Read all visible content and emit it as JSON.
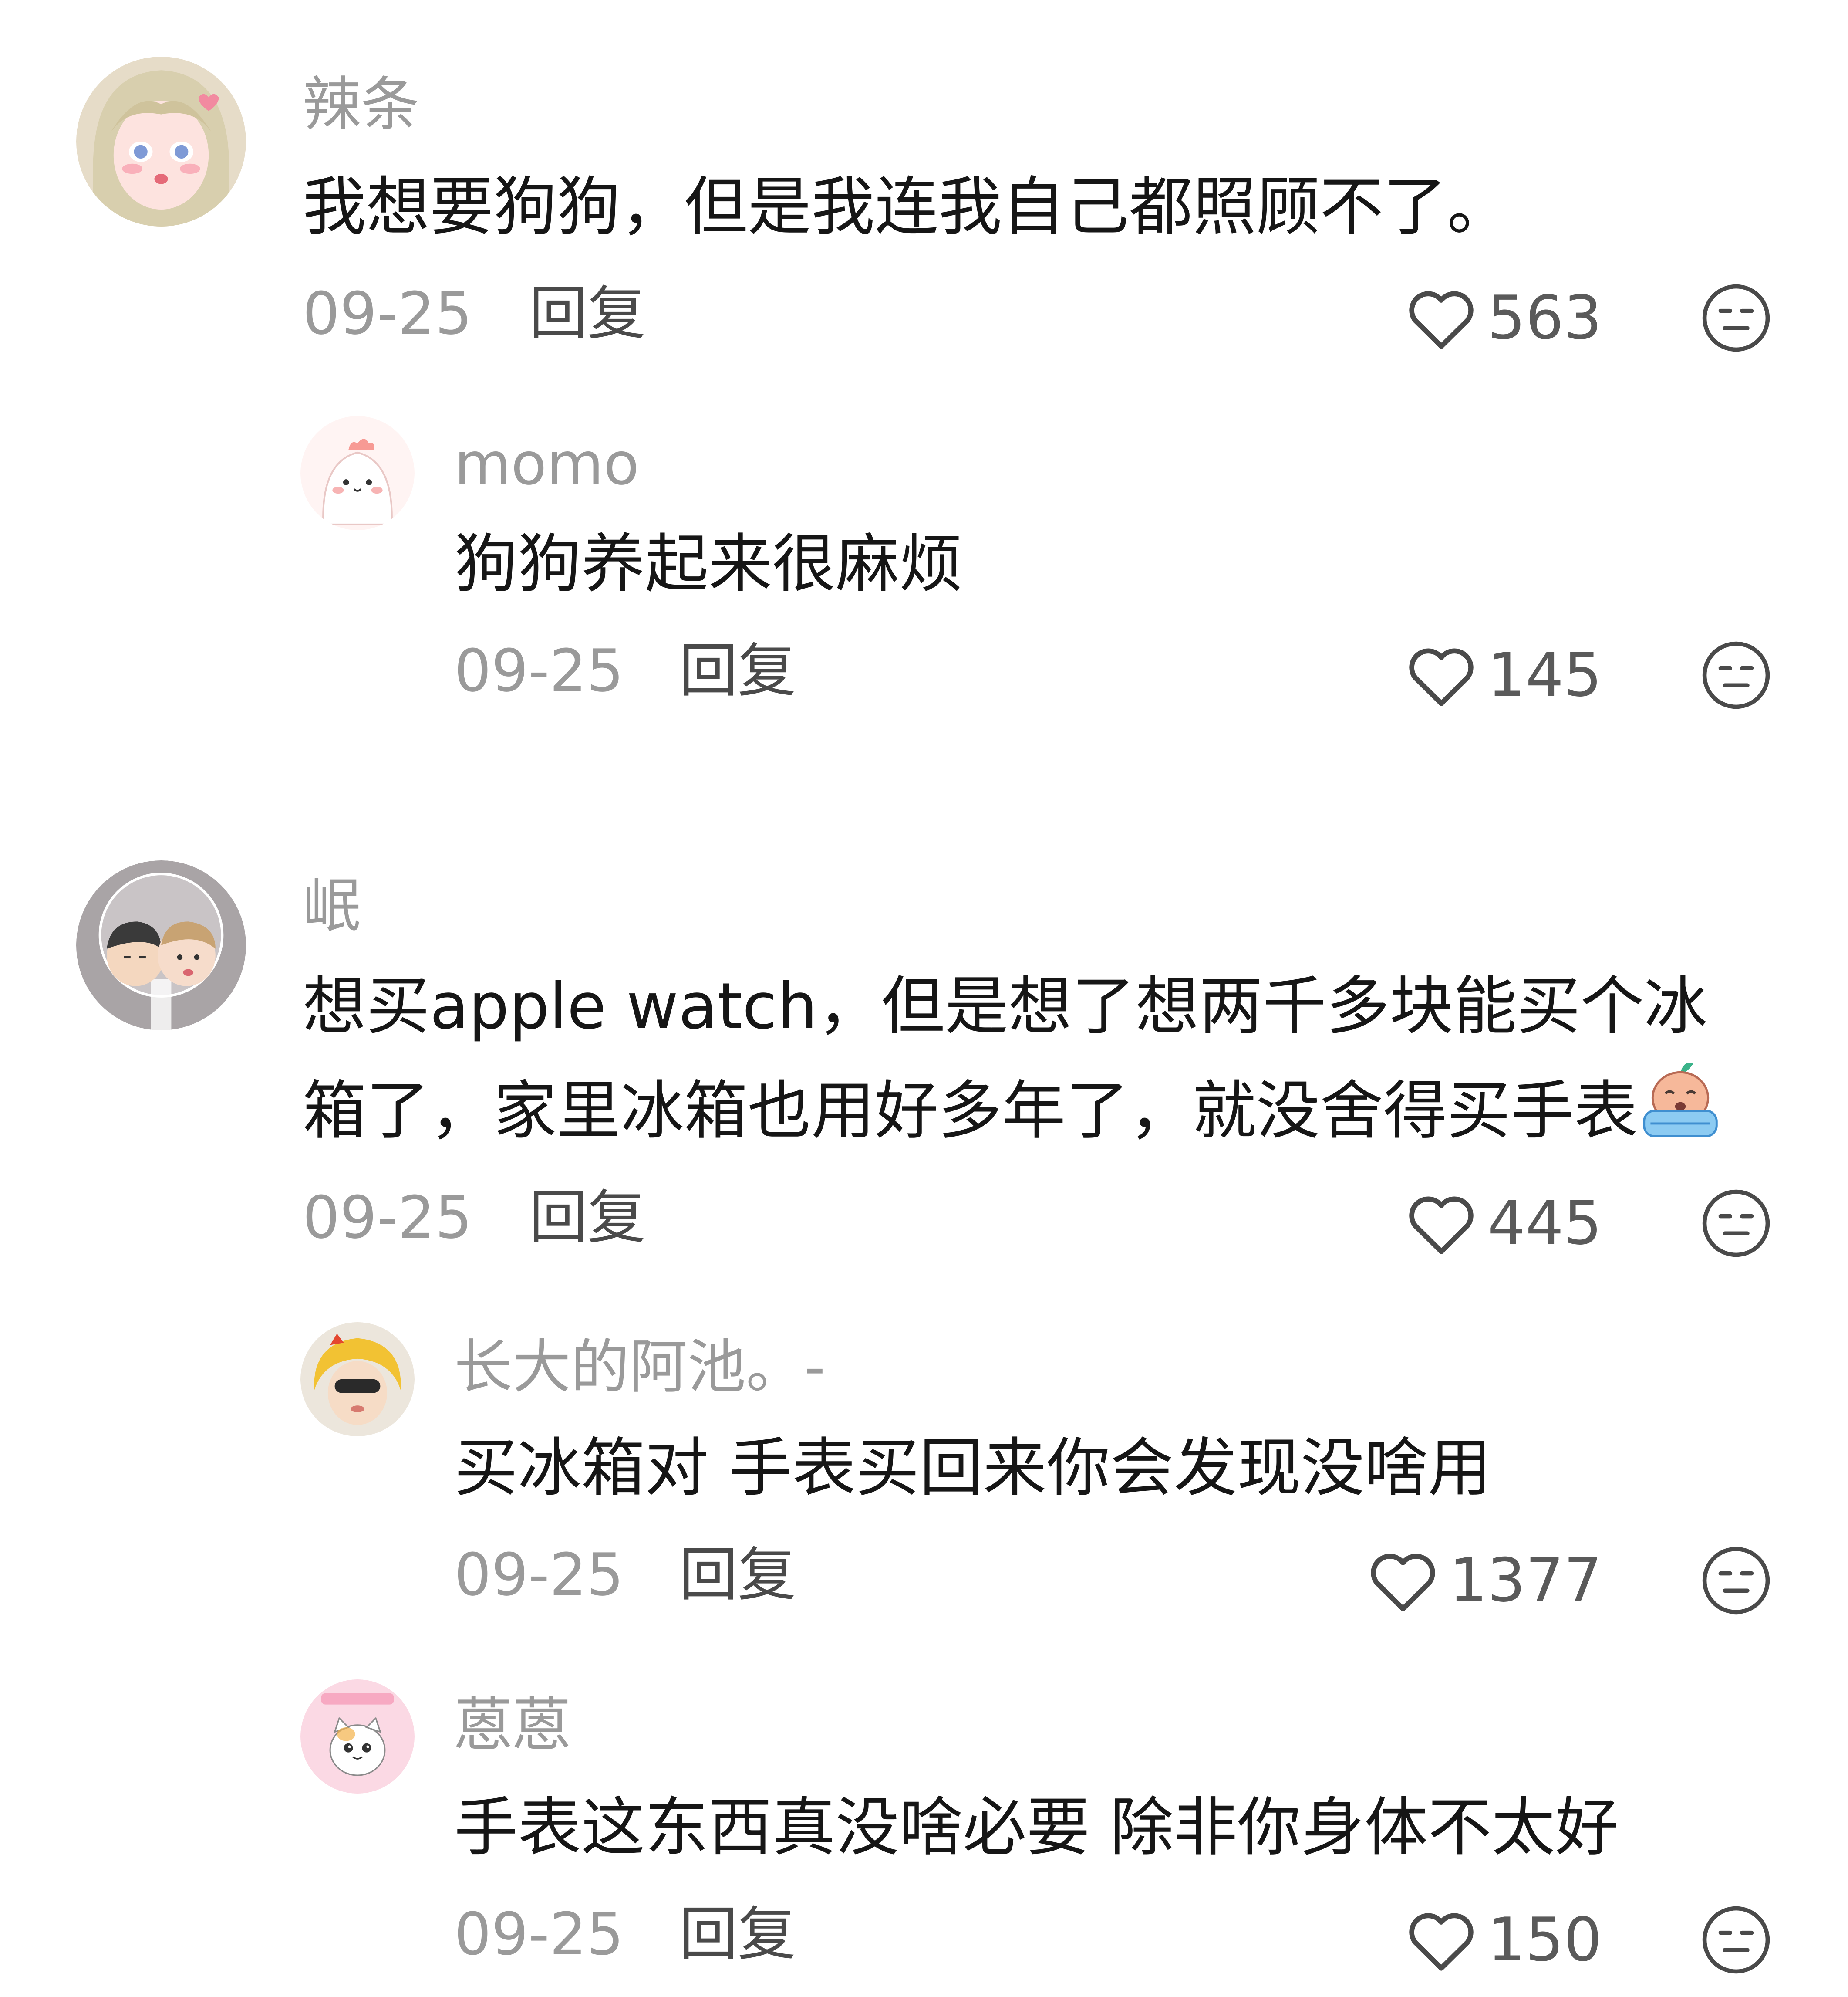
{
  "comments": [
    {
      "username": "辣条",
      "text": "我想要狗狗，但是我连我自己都照顾不了。",
      "date": "09-25",
      "reply_label": "回复",
      "likes": "563",
      "replies": [
        {
          "username": "momo",
          "text": "狗狗养起来很麻烦",
          "date": "09-25",
          "reply_label": "回复",
          "likes": "145"
        }
      ]
    },
    {
      "username": "岷",
      "text_line1": "想买apple watch，但是想了想两千多块能买个冰",
      "text_line2": "箱了，家里冰箱也用好多年了，就没舍得买手表",
      "date": "09-25",
      "reply_label": "回复",
      "likes": "445",
      "replies": [
        {
          "username": "长大的阿池。-",
          "text": "买冰箱对 手表买回来你会发现没啥用",
          "date": "09-25",
          "reply_label": "回复",
          "likes": "1377"
        },
        {
          "username": "蒽蒽",
          "text": "手表这东西真没啥必要 除非你身体不太好",
          "date": "09-25",
          "reply_label": "回复",
          "likes": "150"
        }
      ]
    }
  ],
  "icons": {
    "like": "heart-outline-icon",
    "dislike": "unamused-face-icon",
    "inline_emoji": "crying-emoji-icon"
  },
  "colors": {
    "username": "#9a9a9a",
    "body_text": "#161616",
    "meta": "#9a9a9a",
    "icon_stroke": "#4a4a4a"
  }
}
